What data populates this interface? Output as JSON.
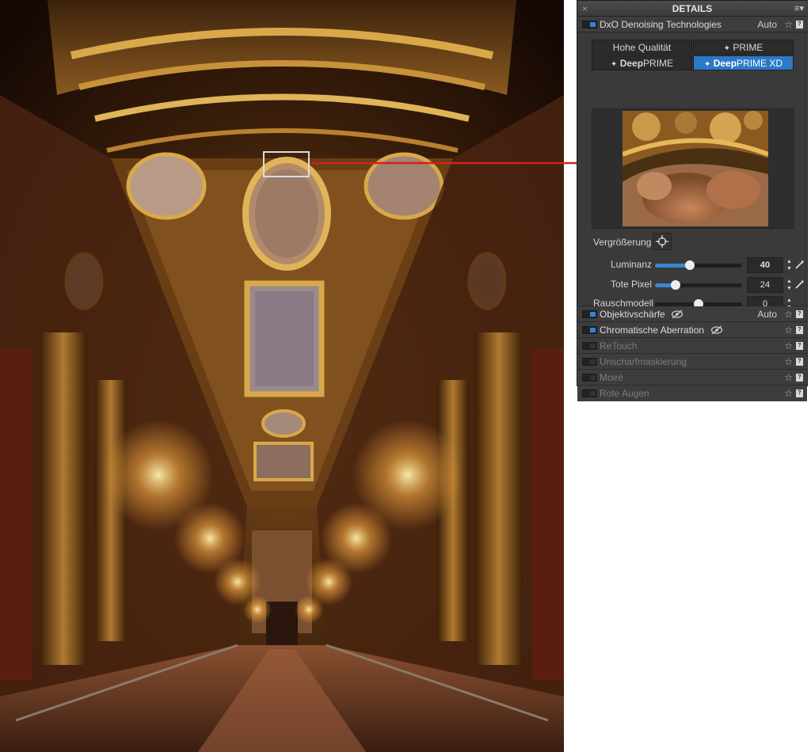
{
  "panel": {
    "title": "DETAILS",
    "close_icon": "×",
    "menu_icon": "≡▾"
  },
  "denoise": {
    "name": "DxO Denoising Technologies",
    "auto": "Auto",
    "modes": {
      "hq": "Hohe Qualität",
      "prime": "PRIME",
      "deep_a": "Deep",
      "deep_b": "PRIME",
      "deepxd_a": "Deep",
      "deepxd_b": "PRIME XD"
    },
    "active_mode": "DeepPRIME XD",
    "magnifier_label": "Vergrößerung",
    "sliders": [
      {
        "label": "Luminanz",
        "value": "40",
        "level": 0.4
      },
      {
        "label": "Tote Pixel",
        "value": "24",
        "level": 0.24
      },
      {
        "label": "Rauschmodell",
        "value": "0",
        "level": 0.5
      }
    ]
  },
  "sections": [
    {
      "name": "Objektivschärfe",
      "auto": "Auto",
      "enabled": true
    },
    {
      "name": "Chromatische Aberration",
      "auto": "",
      "enabled": true
    },
    {
      "name": "ReTouch",
      "auto": "",
      "enabled": false
    },
    {
      "name": "Unscharfmaskierung",
      "auto": "",
      "enabled": false
    },
    {
      "name": "Moiré",
      "auto": "",
      "enabled": false
    },
    {
      "name": "Rote Augen",
      "auto": "",
      "enabled": false
    }
  ],
  "icons": {
    "star": "☆",
    "help": "?",
    "sparkle": "✦"
  },
  "colors": {
    "accent": "#2c79c7",
    "arrow": "#d42020",
    "panel_bg": "#3a3a3a"
  }
}
